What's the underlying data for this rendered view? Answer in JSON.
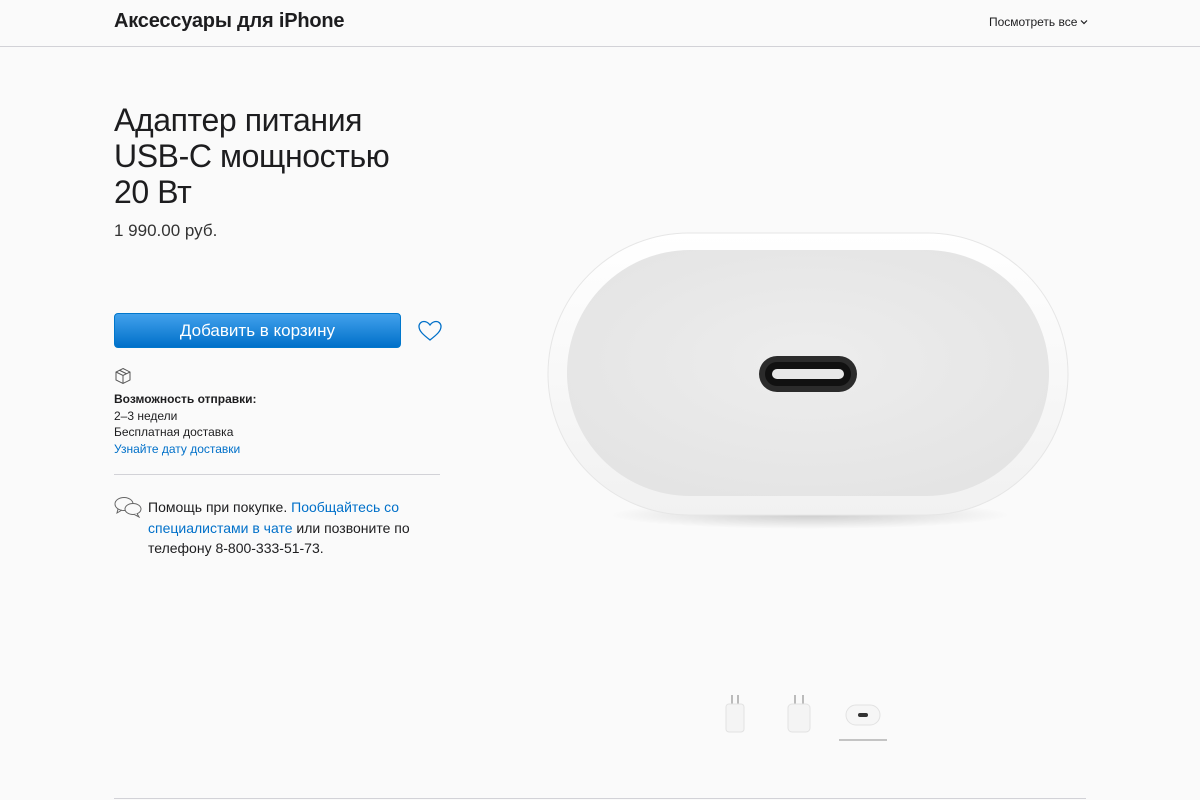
{
  "header": {
    "title": "Аксессуары для iPhone",
    "view_all": "Посмотреть все"
  },
  "product": {
    "title_lines": [
      "Адаптер питания",
      "USB‑C мощностью",
      "20 Вт"
    ],
    "price": "1 990.00 руб.",
    "add_to_bag": "Добавить в корзину"
  },
  "shipping": {
    "heading": "Возможность отправки:",
    "time": "2–3 недели",
    "free": "Бесплатная доставка",
    "link": "Узнайте дату доставки"
  },
  "help": {
    "text1": "Помощь при покупке. ",
    "link": "Пообщайтесь со специалистами в чате",
    "text2": " или позвоните по телефону 8‑800‑333‑51‑73."
  },
  "gallery": {
    "thumbnails": [
      "adapter-front",
      "adapter-side",
      "adapter-port"
    ],
    "selected_index": 2
  },
  "colors": {
    "link": "#0070c9",
    "button_top": "#42a1ec",
    "button_bottom": "#0070c9",
    "background": "#fafafa"
  }
}
